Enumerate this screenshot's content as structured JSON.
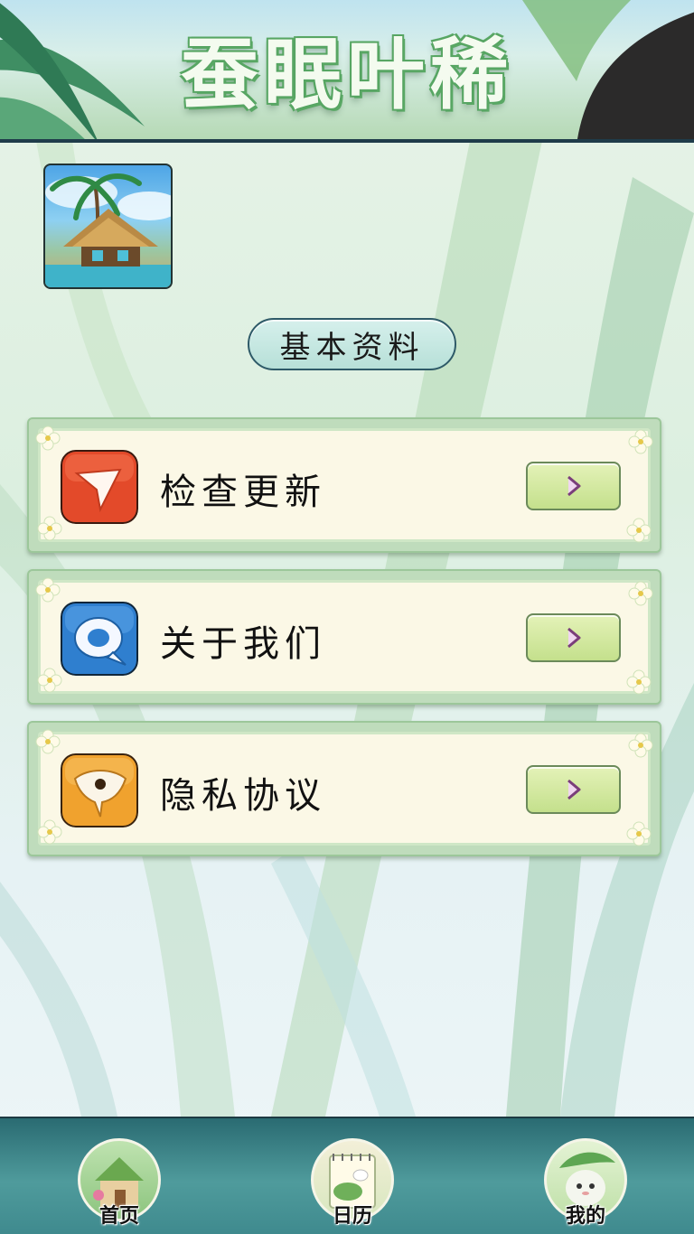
{
  "app": {
    "title": "蚕眠叶稀"
  },
  "profile": {
    "section_title": "基本资料"
  },
  "menu": [
    {
      "label": "检查更新",
      "icon": "arrow-pointer-icon",
      "color": "#e34a2a"
    },
    {
      "label": "关于我们",
      "icon": "chat-bubble-icon",
      "color": "#2f7fcf"
    },
    {
      "label": "隐私协议",
      "icon": "shield-mask-icon",
      "color": "#f0a22e"
    }
  ],
  "nav": [
    {
      "label": "首页",
      "icon": "home-cottage-icon"
    },
    {
      "label": "日历",
      "icon": "calendar-notebook-icon"
    },
    {
      "label": "我的",
      "icon": "silkworm-avatar-icon"
    }
  ]
}
